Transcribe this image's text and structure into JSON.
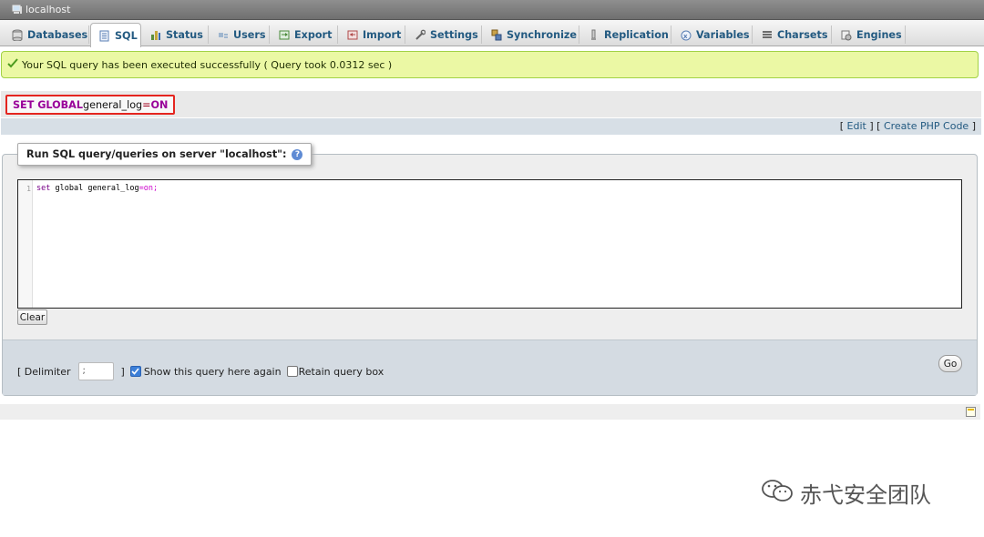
{
  "window": {
    "server_label": "localhost"
  },
  "tabs": [
    {
      "label": "Databases",
      "icon": "database-icon"
    },
    {
      "label": "SQL",
      "icon": "sql-document-icon"
    },
    {
      "label": "Status",
      "icon": "status-chart-icon"
    },
    {
      "label": "Users",
      "icon": "users-icon"
    },
    {
      "label": "Export",
      "icon": "export-icon"
    },
    {
      "label": "Import",
      "icon": "import-icon"
    },
    {
      "label": "Settings",
      "icon": "wrench-icon"
    },
    {
      "label": "Synchronize",
      "icon": "synchronize-icon"
    },
    {
      "label": "Replication",
      "icon": "replication-icon"
    },
    {
      "label": "Variables",
      "icon": "variables-icon"
    },
    {
      "label": "Charsets",
      "icon": "charsets-icon"
    },
    {
      "label": "Engines",
      "icon": "engines-icon"
    }
  ],
  "active_tab": "SQL",
  "message": {
    "text": "Your SQL query has been executed successfully ( Query took 0.0312 sec )",
    "type": "success"
  },
  "executed_query": {
    "kw1": "SET GLOBAL",
    "name": "general_log",
    "op": "=",
    "value": "ON"
  },
  "query_links": {
    "open1": "[",
    "edit": "Edit",
    "mid": "] [",
    "php": "Create PHP Code",
    "close": "]"
  },
  "run_box": {
    "legend": "Run SQL query/queries on server \"localhost\":"
  },
  "editor": {
    "line_number": "1",
    "code": {
      "kw1": "set",
      "kw2": "global",
      "name": "general_log",
      "op": "=",
      "value": "on",
      "semi": ";"
    }
  },
  "buttons": {
    "clear": "Clear",
    "go": "Go"
  },
  "options": {
    "delimiter_open": "[ Delimiter",
    "delimiter_value": ";",
    "delimiter_close": "]",
    "show_query_label": "Show this query here again",
    "show_query_checked": true,
    "retain_box_label": "Retain query box",
    "retain_box_checked": false
  },
  "watermark": {
    "text": "赤弋安全团队"
  },
  "colors": {
    "accent": "#235a81",
    "success_bg": "#ebf8a4",
    "highlight_border": "#e4251f",
    "keyword": "#990099"
  }
}
